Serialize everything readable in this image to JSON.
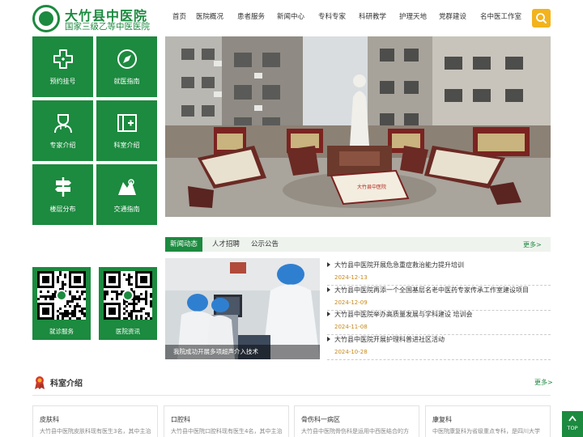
{
  "header": {
    "title": "大竹县中医院",
    "subtitle": "国家三级乙等中医医院",
    "nav": [
      "首页",
      "医院概况",
      "患者服务",
      "新闻中心",
      "专科专家",
      "科研教学",
      "护理天地",
      "党群建设",
      "名中医工作室"
    ]
  },
  "quick_links": [
    {
      "label": "预约挂号",
      "icon": "medical-cross-icon"
    },
    {
      "label": "就医指南",
      "icon": "compass-icon"
    },
    {
      "label": "专家介绍",
      "icon": "doctor-icon"
    },
    {
      "label": "科室介绍",
      "icon": "department-icon"
    },
    {
      "label": "楼层分布",
      "icon": "signpost-icon"
    },
    {
      "label": "交通指南",
      "icon": "map-icon"
    }
  ],
  "banner": {
    "plaque_text": "大竹县中医院",
    "slide_count": 3,
    "active_slide": 1
  },
  "news": {
    "tabs": [
      "新闻动态",
      "人才招聘",
      "公示公告"
    ],
    "more": "更多>",
    "image_caption": "我院成功开展多项超声介入技术",
    "items": [
      {
        "title": "大竹县中医院开展危急重症救治能力提升培训",
        "date": "2024-12-13"
      },
      {
        "title": "大竹县中医院再添一个全国基层名老中医药专家传承工作室建设项目",
        "date": "2024-12-09"
      },
      {
        "title": "大竹县中医院举办高质量发展与学科建设 培训会",
        "date": "2024-11-08"
      },
      {
        "title": "大竹县中医院开展护理科普进社区活动",
        "date": "2024-10-28"
      }
    ]
  },
  "qr": [
    {
      "label": "就诊服务"
    },
    {
      "label": "医院资讯"
    }
  ],
  "departments": {
    "title": "科室介绍",
    "more": "更多>",
    "items": [
      {
        "name": "皮肤科",
        "desc": "大竹县中医院皮肤科现有医生3名，其中主治"
      },
      {
        "name": "口腔科",
        "desc": "大竹县中医院口腔科现有医生4名，其中主治"
      },
      {
        "name": "骨伤科一病区",
        "desc": "大竹县中医院骨伤科是运用中西医结合的方"
      },
      {
        "name": "康复科",
        "desc": "中医院康复科为省级重点专科，是四川大学"
      }
    ]
  },
  "back_to_top": "TOP",
  "colors": {
    "brand": "#1c8a3f",
    "accent": "#f2b31d",
    "date": "#c8891a"
  }
}
